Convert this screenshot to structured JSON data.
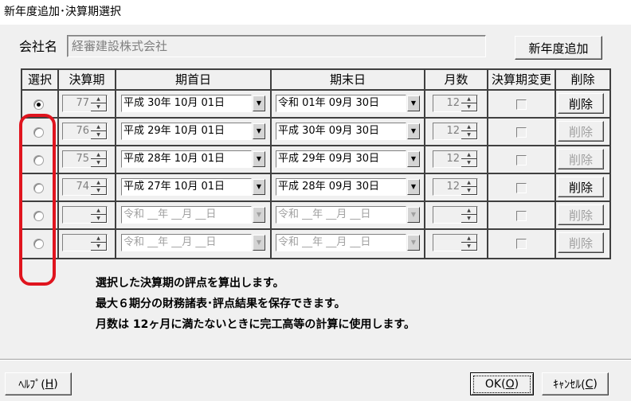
{
  "window": {
    "title": "新年度追加･決算期選択"
  },
  "company": {
    "label": "会社名",
    "value": "経審建設株式会社"
  },
  "buttons": {
    "new_year": "新年度追加",
    "help": "ﾍﾙﾌﾟ(H)",
    "help_prefix": "ﾍﾙﾌﾟ(",
    "help_key": "H",
    "ok_prefix": "OK(",
    "ok_key": "O",
    "cancel_prefix": "ｷｬﾝｾﾙ(",
    "cancel_key": "C",
    "suffix": ")"
  },
  "table": {
    "headers": [
      "選択",
      "決算期",
      "期首日",
      "期末日",
      "月数",
      "決算期変更",
      "削除"
    ],
    "rows": [
      {
        "selected": true,
        "period": "77",
        "start": "平成 30年 10月 01日",
        "end": "令和 01年 09月 30日",
        "months": "12",
        "change_checked": false,
        "delete_label": "削除",
        "delete_enabled": true,
        "dates_enabled": true
      },
      {
        "selected": false,
        "period": "76",
        "start": "平成 29年 10月 01日",
        "end": "平成 30年 09月 30日",
        "months": "12",
        "change_checked": false,
        "delete_label": "削除",
        "delete_enabled": false,
        "dates_enabled": true
      },
      {
        "selected": false,
        "period": "75",
        "start": "平成 28年 10月 01日",
        "end": "平成 29年 09月 30日",
        "months": "12",
        "change_checked": false,
        "delete_label": "削除",
        "delete_enabled": false,
        "dates_enabled": true
      },
      {
        "selected": false,
        "period": "74",
        "start": "平成 27年 10月 01日",
        "end": "平成 28年 09月 30日",
        "months": "12",
        "change_checked": false,
        "delete_label": "削除",
        "delete_enabled": true,
        "dates_enabled": true
      },
      {
        "selected": false,
        "period": "",
        "start": "令和 __年 __月 __日",
        "end": "令和 __年 __月 __日",
        "months": "",
        "change_checked": false,
        "delete_label": "削除",
        "delete_enabled": false,
        "dates_enabled": false
      },
      {
        "selected": false,
        "period": "",
        "start": "令和 __年 __月 __日",
        "end": "令和 __年 __月 __日",
        "months": "",
        "change_checked": false,
        "delete_label": "削除",
        "delete_enabled": false,
        "dates_enabled": false
      }
    ]
  },
  "notes": [
    "選択した決算期の評点を算出します。",
    "最大６期分の財務諸表･評点結果を保存できます。",
    "月数は 12ヶ月に満たないときに完工高等の計算に使用します。"
  ],
  "colors": {
    "highlight": "#e0141e",
    "disabled_text": "#a0a0a0",
    "face": "#f0f0f0"
  }
}
